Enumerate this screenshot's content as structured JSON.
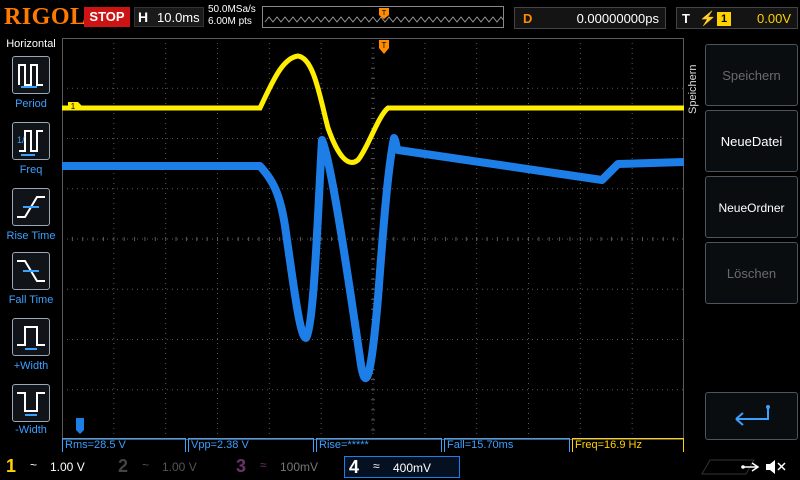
{
  "header": {
    "logo": "RIGOL",
    "run_state": "STOP",
    "horizontal_label": "H",
    "timebase": "10.0ms",
    "sample_rate": "50.0MSa/s",
    "memory_depth": "6.00M pts",
    "delay_label": "D",
    "delay_value": "0.00000000ps",
    "trigger_label": "T",
    "trigger_source": "1",
    "trigger_level": "0.00V"
  },
  "left_panel": {
    "title": "Horizontal",
    "items": [
      {
        "label": "Period",
        "icon": "period-icon"
      },
      {
        "label": "Freq",
        "icon": "freq-icon"
      },
      {
        "label": "Rise Time",
        "icon": "rise-time-icon"
      },
      {
        "label": "Fall Time",
        "icon": "fall-time-icon"
      },
      {
        "label": "+Width",
        "icon": "positive-width-icon"
      },
      {
        "label": "-Width",
        "icon": "negative-width-icon"
      }
    ]
  },
  "right_menu": {
    "title": "Speichern",
    "items": [
      {
        "label": "Speichern",
        "enabled": false
      },
      {
        "label": "NeueDatei",
        "enabled": true
      },
      {
        "label": "NeueOrdner",
        "enabled": true
      },
      {
        "label": "Löschen",
        "enabled": false
      }
    ]
  },
  "markers": {
    "ch1_level": "1",
    "trigger_position": "T"
  },
  "measurements": [
    {
      "text": "Rms=28.5 V",
      "color": "#3ca0ff"
    },
    {
      "text": "Vpp=2.38 V",
      "color": "#3ca0ff"
    },
    {
      "text": "Rise=*****",
      "color": "#3ca0ff"
    },
    {
      "text": "Fall=15.70ms",
      "color": "#3ca0ff"
    },
    {
      "text": "Freq=16.9 Hz",
      "color": "#ffd200"
    }
  ],
  "channels": [
    {
      "num": "1",
      "coupling": "~",
      "scale": "1.00 V",
      "color": "#ffd200",
      "active": true
    },
    {
      "num": "2",
      "coupling": "~",
      "scale": "1.00 V",
      "color": "#3a3a3a",
      "active": false
    },
    {
      "num": "3",
      "coupling": "≈",
      "scale": "100mV",
      "color": "#5a2a55",
      "active": false
    },
    {
      "num": "4",
      "coupling": "≈",
      "scale": "400mV",
      "color": "#1e7ee8",
      "active": true
    }
  ],
  "colors": {
    "ch1": "#ffee00",
    "ch4": "#1e7ee8",
    "grid": "#5a5a5a",
    "trigger": "#ff8c00"
  }
}
